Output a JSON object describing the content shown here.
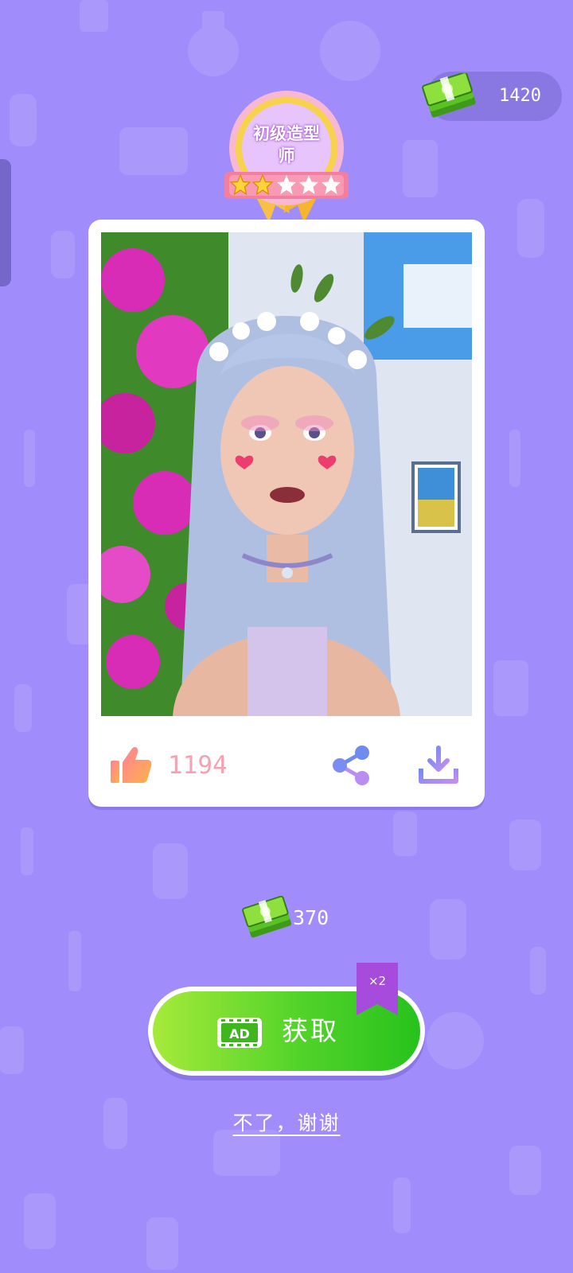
{
  "header": {
    "coin_balance": "1420",
    "coin_icon": "money-stack-icon"
  },
  "badge": {
    "title": "初级造型师",
    "stars_total": 5,
    "stars_filled": 2
  },
  "card": {
    "photo": "avatar-portrait",
    "likes": "1194",
    "like_icon": "thumbs-up-icon",
    "share_icon": "share-icon",
    "download_icon": "download-icon"
  },
  "reward": {
    "amount": "370",
    "icon": "money-stack-icon"
  },
  "actions": {
    "get_ad_label": "AD",
    "get_label": "获取",
    "multiplier": "×2",
    "no_thanks_label": "不了，谢谢"
  },
  "colors": {
    "background": "#a08cfb",
    "button_green": "#52d32a",
    "like_pink": "#f6a1b2",
    "share_blue": "#6f8bf0",
    "flag_purple": "#a64bdc"
  }
}
